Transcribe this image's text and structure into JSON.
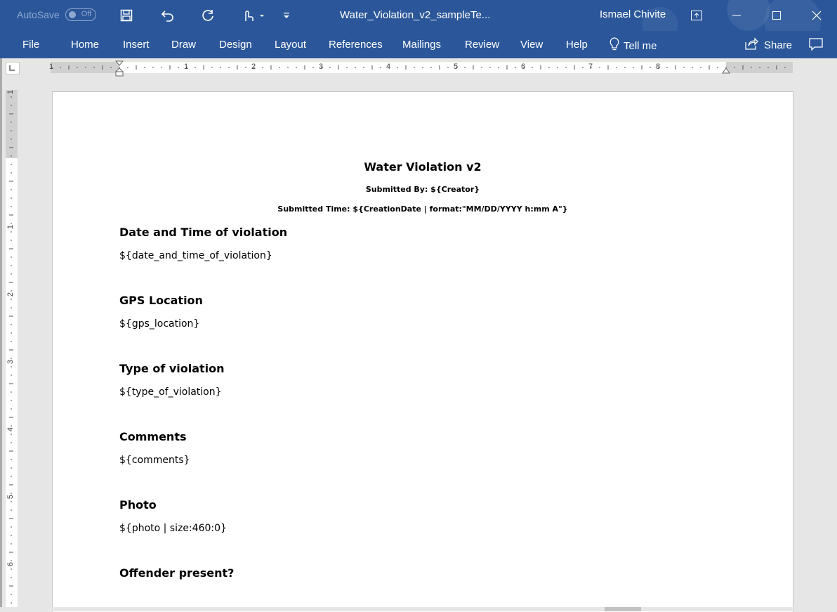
{
  "titlebar": {
    "autosave_label": "AutoSave",
    "autosave_state": "Off",
    "doc_title": "Water_Violation_v2_sampleTe...",
    "user_name": "Ismael Chivite",
    "bg_color": "#2b579a"
  },
  "ribbon": {
    "tabs": [
      "File",
      "Home",
      "Insert",
      "Draw",
      "Design",
      "Layout",
      "References",
      "Mailings",
      "Review",
      "View",
      "Help"
    ],
    "tell_me": "Tell me",
    "share": "Share"
  },
  "ruler": {
    "h_numbers": [
      "1",
      "1",
      "2",
      "3",
      "4",
      "5",
      "6",
      "7",
      "8"
    ],
    "v_numbers": [
      "1",
      "1",
      "2",
      "3",
      "4",
      "5",
      "6"
    ]
  },
  "document": {
    "title": "Water Violation v2",
    "submitted_by": "Submitted By: ${Creator}",
    "submitted_time": "Submitted Time: ${CreationDate | format:\"MM/DD/YYYY h:mm A\"}",
    "sections": [
      {
        "heading": "Date and Time of violation",
        "value": "${date_and_time_of_violation}"
      },
      {
        "heading": "GPS Location",
        "value": "${gps_location}"
      },
      {
        "heading": "Type of violation",
        "value": "${type_of_violation}"
      },
      {
        "heading": "Comments",
        "value": "${comments}"
      },
      {
        "heading": "Photo",
        "value": "${photo | size:460:0}"
      },
      {
        "heading": "Offender present?",
        "value": ""
      }
    ]
  }
}
